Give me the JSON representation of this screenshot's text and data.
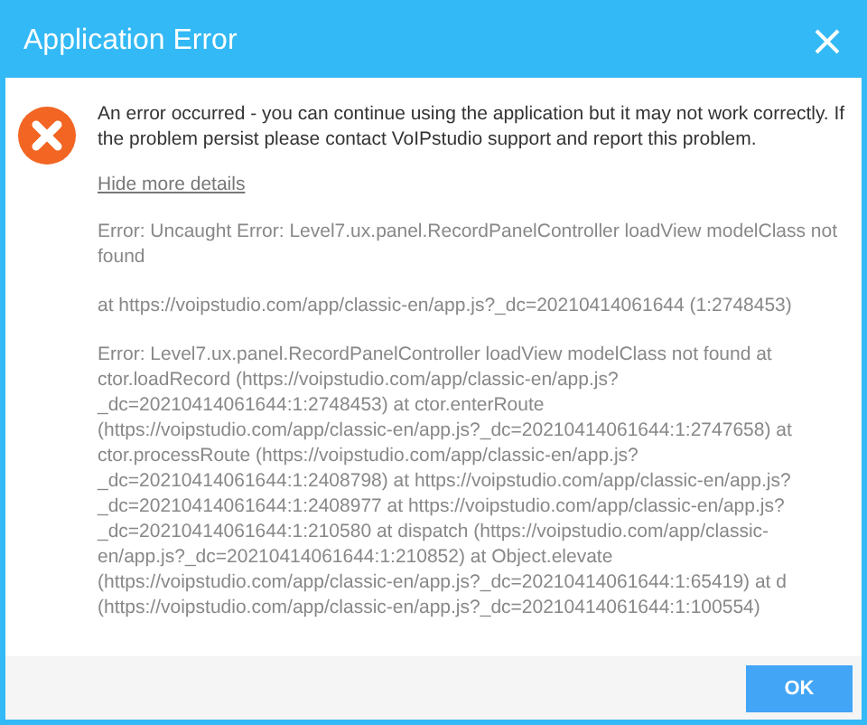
{
  "window": {
    "title": "Application Error"
  },
  "message_lines": [
    "An error occurred - you can continue using the application but it may not work correctly. If",
    "the problem persist please contact VoIPstudio support and report this problem."
  ],
  "details_link": "Hide more details",
  "details": [
    [
      "Error: Uncaught Error: Level7.ux.panel.RecordPanelController loadView modelClass not",
      "found"
    ],
    [
      "at https://voipstudio.com/app/classic-en/app.js?_dc=20210414061644 (1:2748453)"
    ],
    [
      "Error: Level7.ux.panel.RecordPanelController loadView modelClass not found at",
      "ctor.loadRecord (https://voipstudio.com/app/classic-en/app.js?",
      "_dc=20210414061644:1:2748453) at ctor.enterRoute",
      "(https://voipstudio.com/app/classic-en/app.js?_dc=20210414061644:1:2747658) at",
      "ctor.processRoute (https://voipstudio.com/app/classic-en/app.js?",
      "_dc=20210414061644:1:2408798) at https://voipstudio.com/app/classic-en/app.js?",
      "_dc=20210414061644:1:2408977 at https://voipstudio.com/app/classic-en/app.js?",
      "_dc=20210414061644:1:210580 at dispatch (https://voipstudio.com/app/classic-",
      "en/app.js?_dc=20210414061644:1:210852) at Object.elevate",
      "(https://voipstudio.com/app/classic-en/app.js?_dc=20210414061644:1:65419) at d",
      "(https://voipstudio.com/app/classic-en/app.js?_dc=20210414061644:1:100554)"
    ]
  ],
  "buttons": [
    "OK"
  ]
}
